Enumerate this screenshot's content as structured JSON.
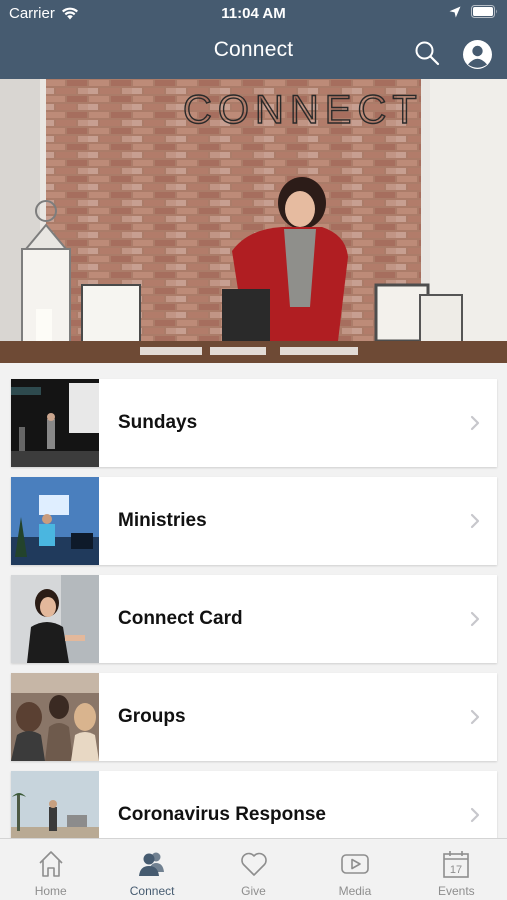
{
  "status_bar": {
    "carrier": "Carrier",
    "time": "11:04 AM"
  },
  "nav": {
    "title": "Connect"
  },
  "hero": {
    "sign_text": "CONNECT"
  },
  "items": [
    {
      "label": "Sundays"
    },
    {
      "label": "Ministries"
    },
    {
      "label": "Connect Card"
    },
    {
      "label": "Groups"
    },
    {
      "label": "Coronavirus Response"
    }
  ],
  "tabs": [
    {
      "label": "Home",
      "icon": "home-icon"
    },
    {
      "label": "Connect",
      "icon": "people-icon",
      "active": true
    },
    {
      "label": "Give",
      "icon": "heart-icon"
    },
    {
      "label": "Media",
      "icon": "play-icon"
    },
    {
      "label": "Events",
      "icon": "calendar-icon",
      "calendar_day": "17"
    }
  ],
  "colors": {
    "header": "#465b70",
    "accent": "#465b70",
    "inactive": "#8e8e8e"
  }
}
